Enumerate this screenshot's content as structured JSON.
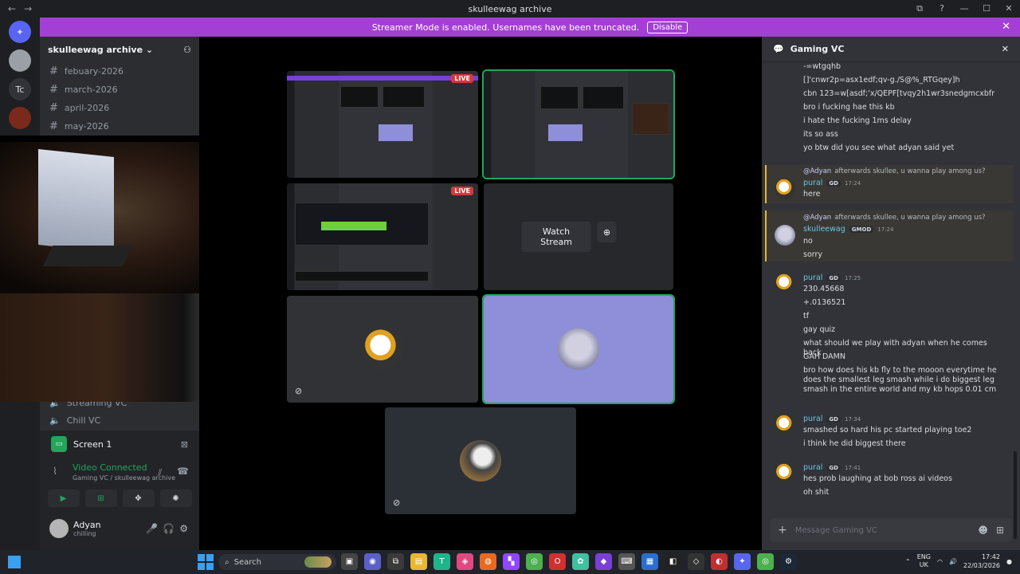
{
  "window": {
    "title": "skulleewag archive",
    "controls": [
      "⧉",
      "?",
      "—",
      "☐",
      "✕"
    ]
  },
  "banner": {
    "text": "Streamer Mode is enabled. Usernames have been truncated.",
    "button": "Disable"
  },
  "servers": [
    "Tc"
  ],
  "sidebar": {
    "server_name": "skulleewag archive",
    "channels": [
      "febuary-2026",
      "march-2026",
      "april-2026",
      "may-2026"
    ],
    "voice_channels": [
      "Streaming VC",
      "Chill VC"
    ]
  },
  "user_panel": {
    "screen_label": "Screen 1",
    "vc_status": "Video Connected",
    "vc_location": "Gaming VC / skulleewag archive",
    "username": "Adyan",
    "status": "chilling"
  },
  "stage": {
    "live_badge": "LIVE",
    "watch_label": "Watch Stream"
  },
  "chat": {
    "channel": "Gaming VC",
    "placeholder": "Message Gaming VC",
    "top_lines": [
      "-=wtgqhb",
      "[]'cnwr2p=asx1edf;qv-g./S@%_RTGqey]h",
      "cbn 123=w[asdf;'x/QEPF[tvqy2h1wr3snedgmcxbfr",
      "bro i fucking hae this kb",
      "i hate the fucking 1ms delay",
      "its so ass",
      "yo btw did you see what adyan said yet"
    ],
    "reply1": {
      "mention": "@Adyan",
      "text": "afterwards skullee, u wanna play among us?",
      "user": "pural",
      "tag": "GD",
      "time": "17:24",
      "body": "here"
    },
    "reply2": {
      "mention": "@Adyan",
      "text": "afterwards skullee, u wanna play among us?",
      "user": "skulleewag",
      "tag": "GMOD",
      "time": "17:24",
      "lines": [
        "no",
        "sorry"
      ]
    },
    "group3": {
      "user": "pural",
      "tag": "GD",
      "time": "17:25",
      "lines": [
        "230.45668",
        "+.0136521",
        "tf",
        "gay quiz",
        "what should we play with adyan when he comes back",
        "GAH DAMN",
        "bro how does his kb fly to the mooon everytime he does the smallest leg smash while i do biggest leg smash in the entire world and my kb hops 0.01 cm"
      ]
    },
    "group4": {
      "user": "pural",
      "tag": "GD",
      "time": "17:34",
      "lines": [
        "smashed so hard his pc started playing toe2",
        "i think he did biggest there"
      ]
    },
    "group5": {
      "user": "pural",
      "tag": "GD",
      "time": "17:41",
      "lines": [
        "hes prob laughing at bob ross ai videos",
        "oh shit"
      ]
    }
  },
  "taskbar": {
    "search_label": "Search",
    "lang": "ENG",
    "region": "UK",
    "time": "17:42",
    "date": "22/03/2026"
  },
  "colors": {
    "accent": "#a43fd5",
    "online": "#23a55a",
    "live": "#da373c"
  }
}
